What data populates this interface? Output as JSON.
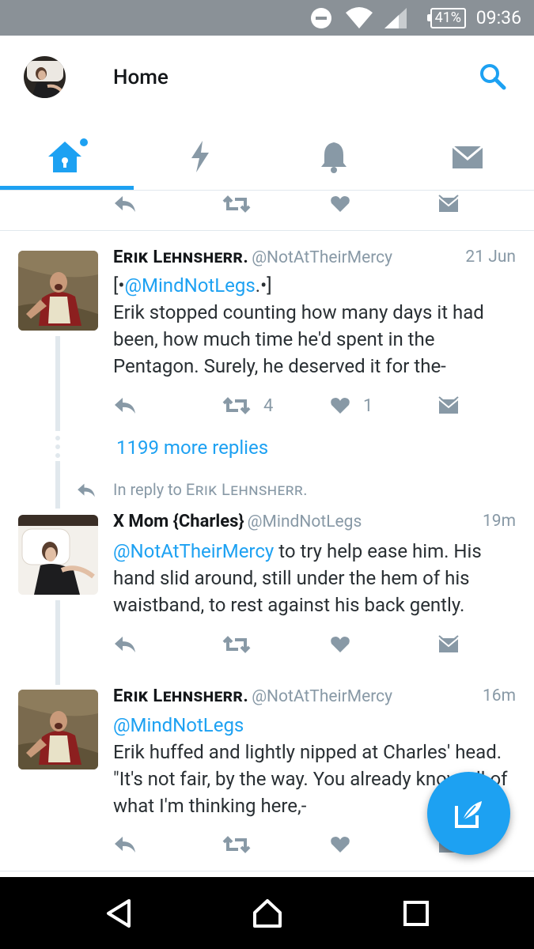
{
  "status_bar": {
    "battery": "41%",
    "time": "09:36"
  },
  "header": {
    "title": "Home"
  },
  "tabs": [
    {
      "name": "home",
      "active": true
    },
    {
      "name": "moments",
      "active": false
    },
    {
      "name": "notifications",
      "active": false
    },
    {
      "name": "messages",
      "active": false
    }
  ],
  "tweets": [
    {
      "name": "Erik Lehnsherr.",
      "handle": "@NotAtTheirMercy",
      "time": "21 Jun",
      "text_prefix": "[•",
      "mention": "@MindNotLegs",
      "text_suffix": ".•]",
      "body": "Erik stopped counting how many days it had been, how much time he'd spent in the Pentagon. Surely, he deserved it for the-",
      "retweets": "4",
      "likes": "1"
    },
    {
      "name": "X Mom {Charles}",
      "handle": "@MindNotLegs",
      "time": "19m",
      "mention": "@NotAtTheirMercy",
      "body": " to try help ease him. His hand slid around, still under the hem of his waistband, to rest against his back gently."
    },
    {
      "name": "Erik Lehnsherr.",
      "handle": "@NotAtTheirMercy",
      "time": "16m",
      "mention": "@MindNotLegs",
      "body": "Erik huffed and lightly nipped at Charles' head. \"It's not fair, by the way. You already know all of what I'm thinking here,-"
    }
  ],
  "more_replies": "1199 more replies",
  "reply_context": {
    "prefix": "In reply to ",
    "name": "Erik Lehnsherr."
  },
  "colors": {
    "accent": "#1da1f2",
    "muted": "#8899a6",
    "status_bar": "#8a9197"
  }
}
